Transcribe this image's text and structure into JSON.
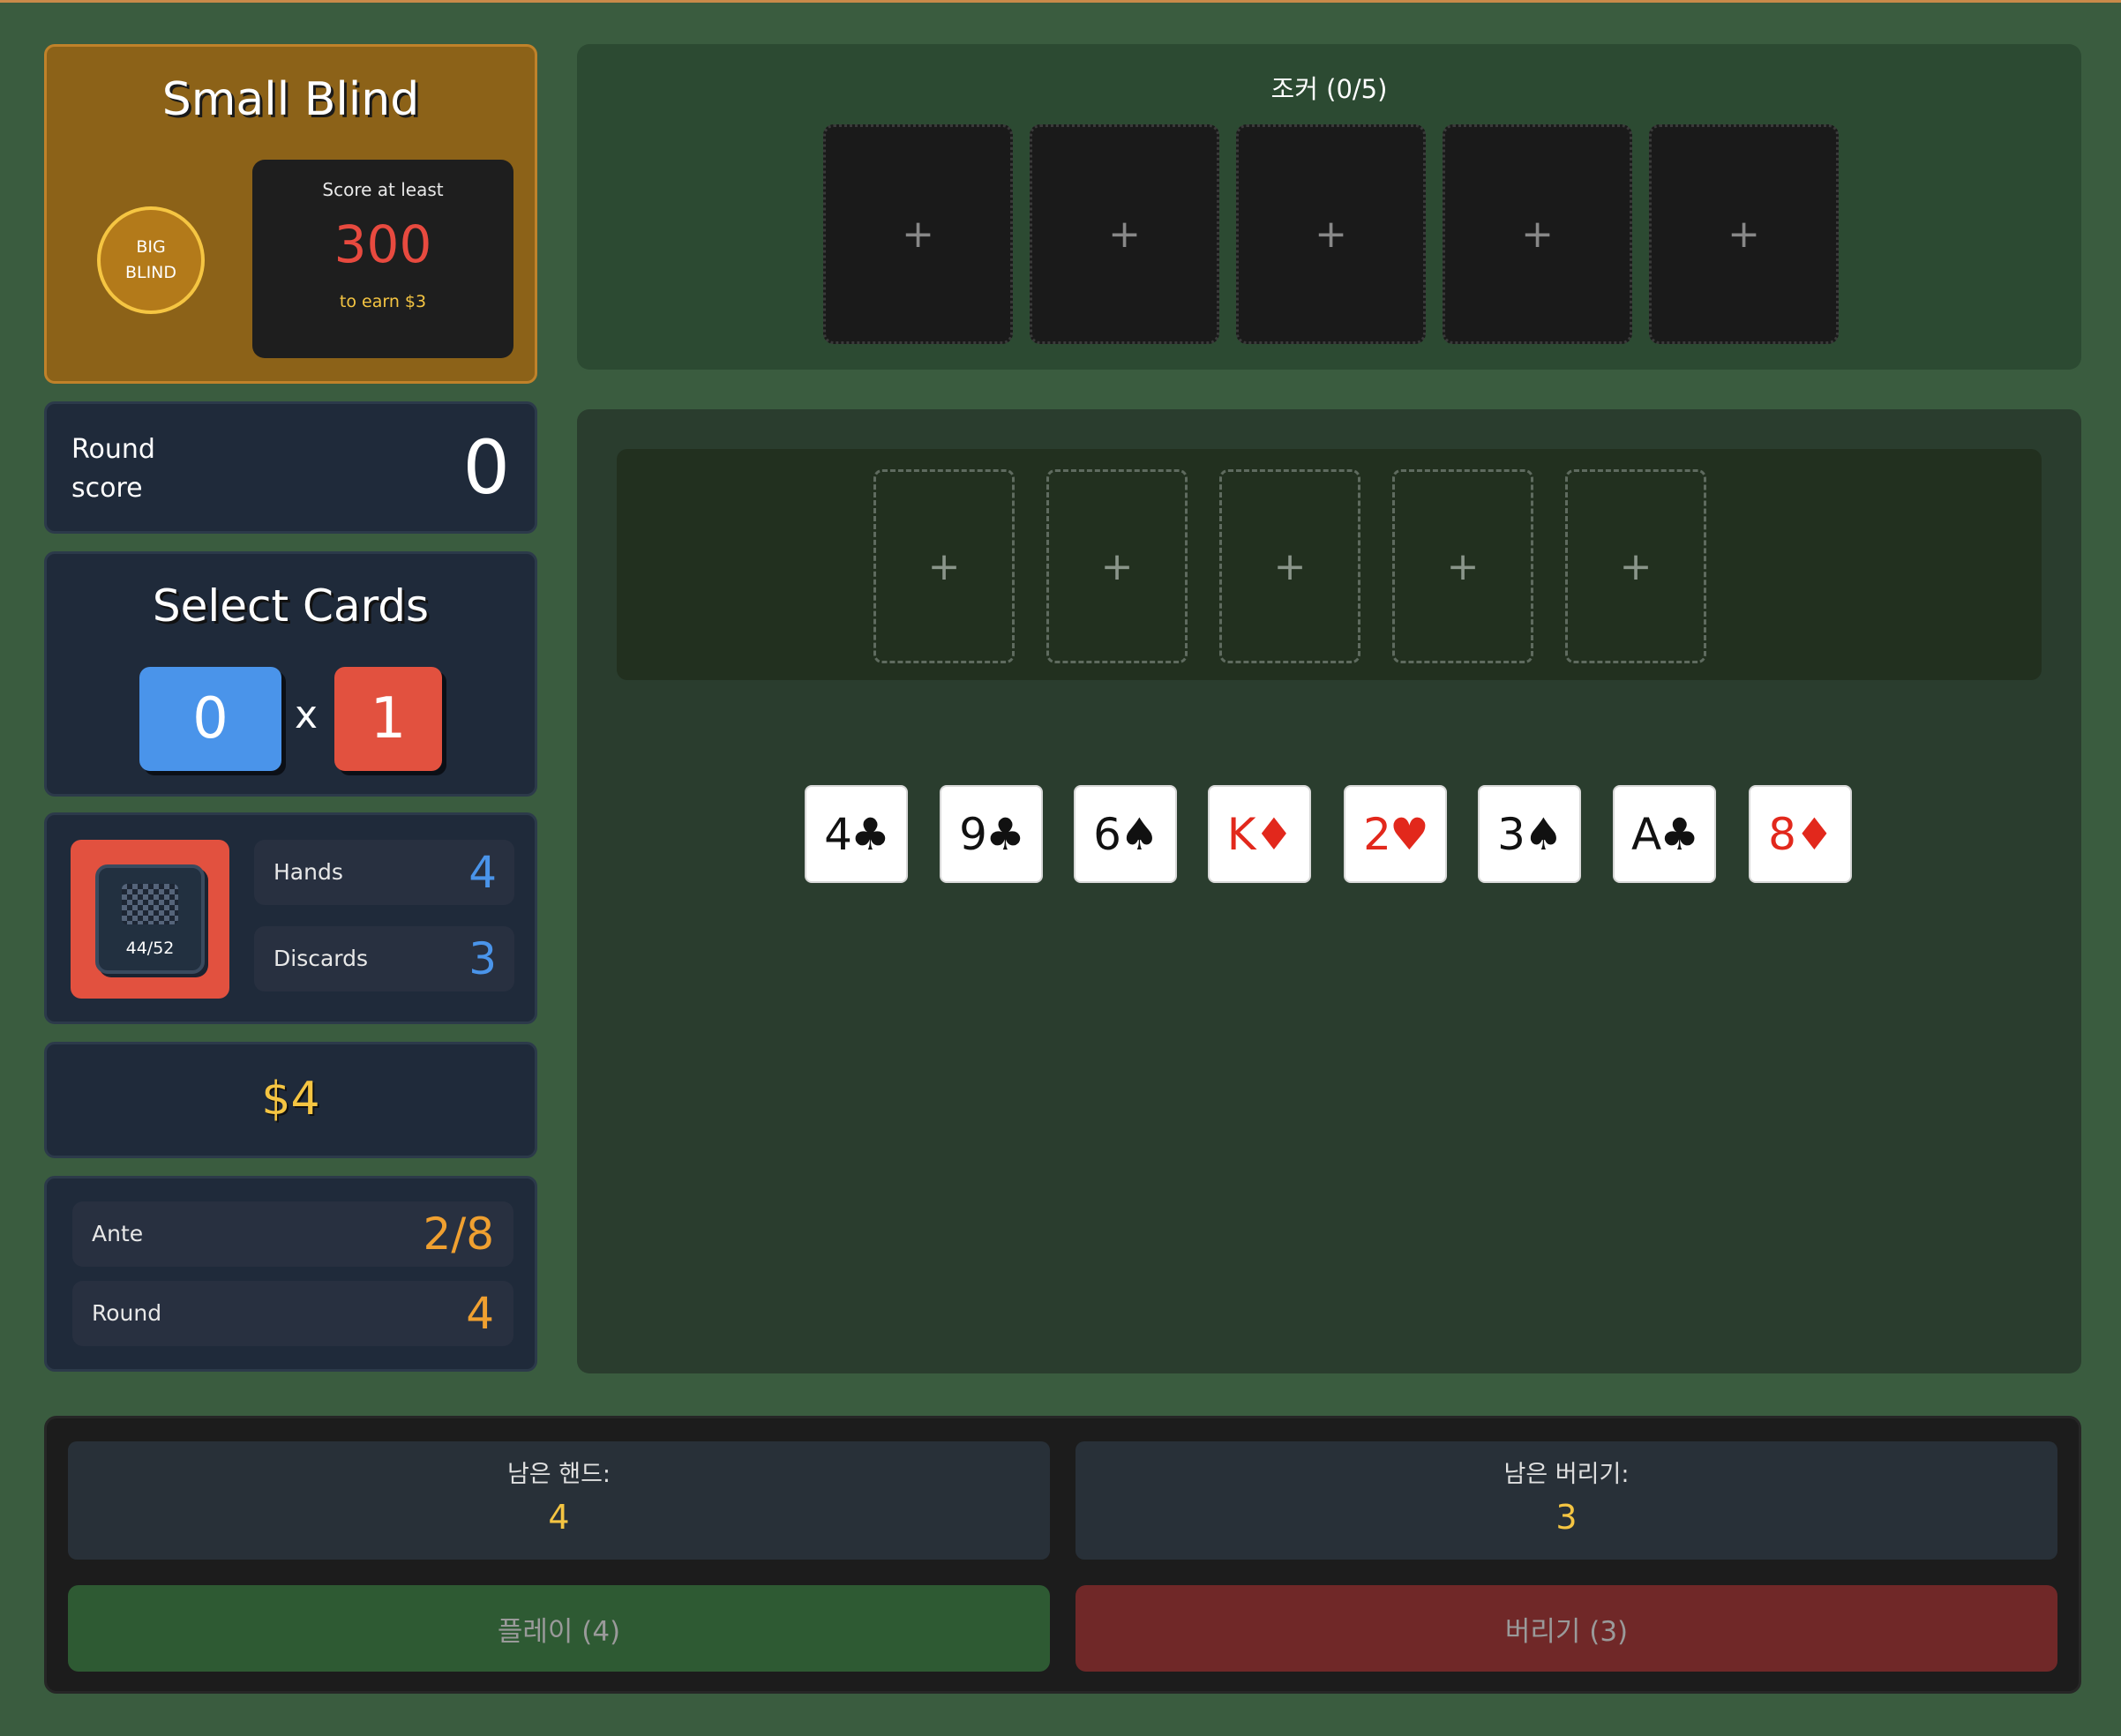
{
  "blind": {
    "title": "Small Blind",
    "chip_line1": "BIG",
    "chip_line2": "BLIND",
    "target_label": "Score at least",
    "target_value": "300",
    "reward": "to earn $3"
  },
  "round_score": {
    "label": "Round score",
    "value": "0"
  },
  "select": {
    "title": "Select Cards",
    "chips": "0",
    "times": "x",
    "mult": "1"
  },
  "deck": {
    "count": "44/52"
  },
  "stats": {
    "hands_label": "Hands",
    "hands_value": "4",
    "discards_label": "Discards",
    "discards_value": "3"
  },
  "money": "$4",
  "ante": {
    "ante_label": "Ante",
    "ante_value": "2/8",
    "round_label": "Round",
    "round_value": "4"
  },
  "jokers": {
    "title": "조커 (0/5)",
    "slot_symbol": "+",
    "slots": [
      "+",
      "+",
      "+",
      "+",
      "+"
    ]
  },
  "play_slots": [
    "+",
    "+",
    "+",
    "+",
    "+"
  ],
  "hand": [
    {
      "label": "4♣",
      "color": "black"
    },
    {
      "label": "9♣",
      "color": "black"
    },
    {
      "label": "6♠",
      "color": "black"
    },
    {
      "label": "K♦",
      "color": "red"
    },
    {
      "label": "2♥",
      "color": "red"
    },
    {
      "label": "3♠",
      "color": "black"
    },
    {
      "label": "A♣",
      "color": "black"
    },
    {
      "label": "8♦",
      "color": "red"
    }
  ],
  "bottom": {
    "hands_left_label": "남은 핸드:",
    "hands_left_value": "4",
    "discards_left_label": "남은 버리기:",
    "discards_left_value": "3",
    "play_button": "플레이 (4)",
    "discard_button": "버리기 (3)"
  },
  "colors": {
    "background": "#3a5c3f",
    "blind_panel": "#8c6218",
    "chips_blue": "#4a94ea",
    "mult_red": "#e2513f",
    "gold": "#f5c542",
    "red_suit": "#e2281c"
  }
}
